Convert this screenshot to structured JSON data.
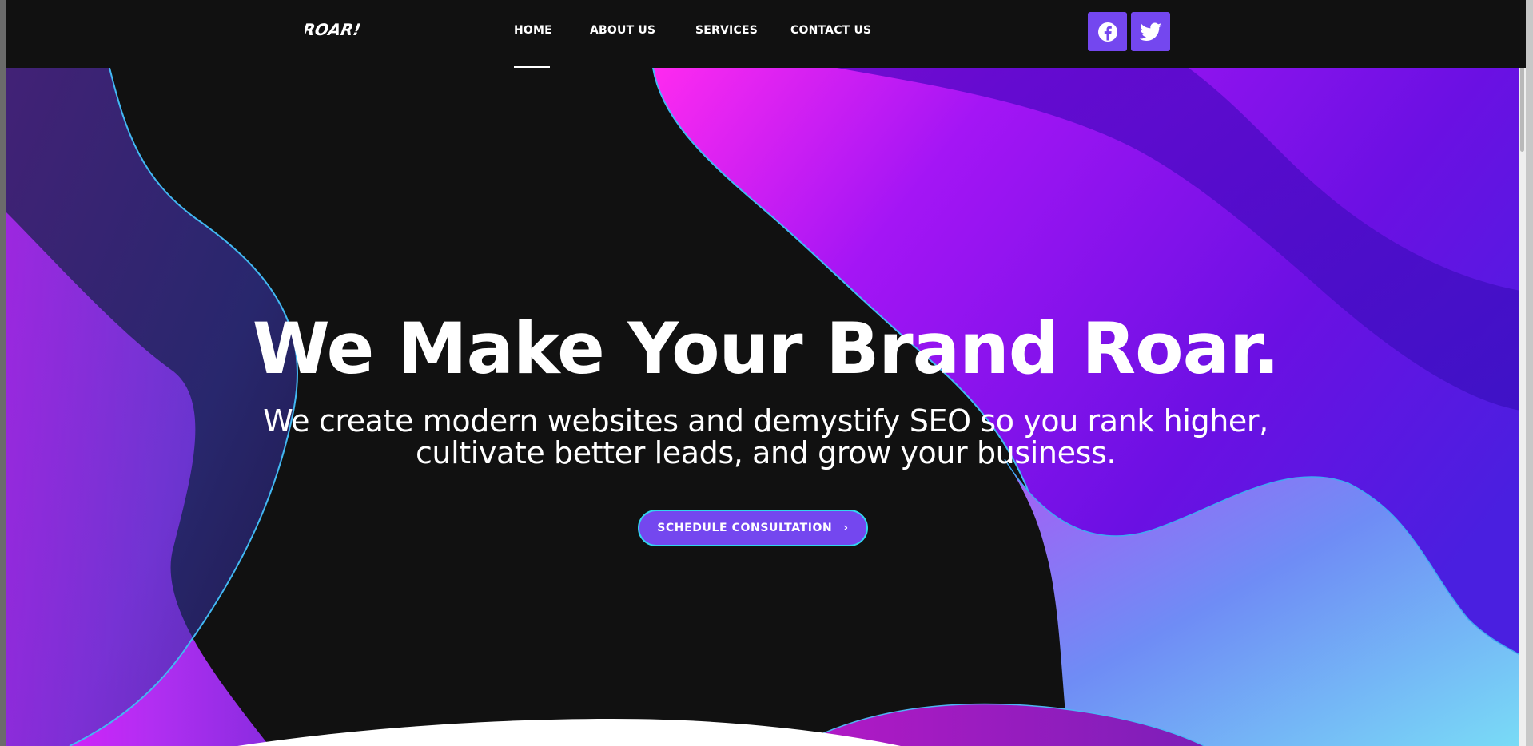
{
  "brand": {
    "logo_text": "ROAR!"
  },
  "nav": {
    "items": [
      {
        "label": "HOME",
        "active": true
      },
      {
        "label": "ABOUT US"
      },
      {
        "label": "SERVICES"
      },
      {
        "label": "CONTACT US"
      }
    ]
  },
  "social": [
    {
      "name": "facebook-icon"
    },
    {
      "name": "twitter-icon"
    }
  ],
  "hero": {
    "title": "We Make Your Brand Roar.",
    "subtitle": "We create modern websites and demystify SEO so you rank higher, cultivate better leads, and grow your business.",
    "cta_label": "SCHEDULE CONSULTATION",
    "cta_icon": "chevron-right-icon"
  },
  "colors": {
    "background": "#111111",
    "accent": "#7447ef",
    "cta_border": "#31d6ee",
    "magenta": "#e61cff",
    "violet": "#7a10f5",
    "cyan": "#7ad8f6"
  }
}
